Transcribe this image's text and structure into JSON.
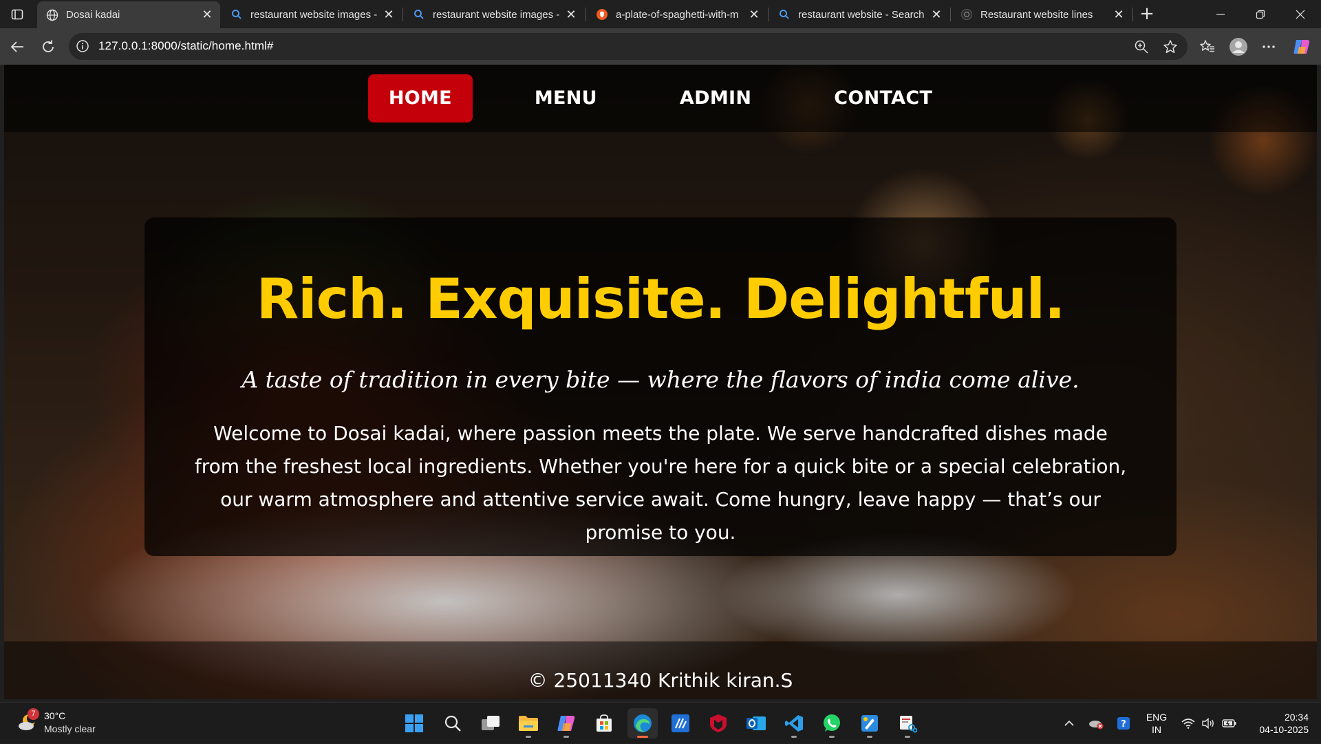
{
  "browser": {
    "tabs": [
      {
        "title": "Dosai kadai",
        "icon": "globe-icon",
        "active": true
      },
      {
        "title": "restaurant website images -",
        "icon": "search-icon",
        "active": false
      },
      {
        "title": "restaurant website images -",
        "icon": "search-icon",
        "active": false
      },
      {
        "title": "a-plate-of-spaghetti-with-m",
        "icon": "brave-icon",
        "active": false
      },
      {
        "title": "restaurant website - Search",
        "icon": "search-icon",
        "active": false
      },
      {
        "title": "Restaurant website lines",
        "icon": "chatgpt-icon",
        "active": false
      }
    ],
    "url": "127.0.0.1:8000/static/home.html#"
  },
  "site": {
    "nav": [
      {
        "label": "HOME",
        "active": true
      },
      {
        "label": "MENU",
        "active": false
      },
      {
        "label": "ADMIN",
        "active": false
      },
      {
        "label": "CONTACT",
        "active": false
      }
    ],
    "hero": {
      "headline": "Rich. Exquisite. Delightful.",
      "tagline": "A taste of tradition in every bite — where the flavors of india come alive.",
      "intro": "Welcome to Dosai kadai, where passion meets the plate. We serve handcrafted dishes made from the freshest local ingredients. Whether you're here for a quick bite or a special celebration, our warm atmosphere and attentive service await. Come hungry, leave happy — that’s our promise to you."
    },
    "footer": "© 25011340 Krithik kiran.S",
    "colors": {
      "accent": "#c4000b",
      "headline": "#ffcc00"
    }
  },
  "taskbar": {
    "weather": {
      "badge": "7",
      "temp": "30°C",
      "condition": "Mostly clear"
    },
    "apps": [
      "windows-start-icon",
      "search-icon",
      "task-view-icon",
      "file-explorer-icon",
      "copilot-icon",
      "microsoft-store-icon",
      "edge-icon",
      "code-app-icon",
      "mcafee-icon",
      "outlook-icon",
      "vscode-icon",
      "whatsapp-icon",
      "paint-icon",
      "snipping-tool-icon"
    ],
    "lang": {
      "line1": "ENG",
      "line2": "IN"
    },
    "clock": {
      "time": "20:34",
      "date": "04-10-2025"
    }
  }
}
